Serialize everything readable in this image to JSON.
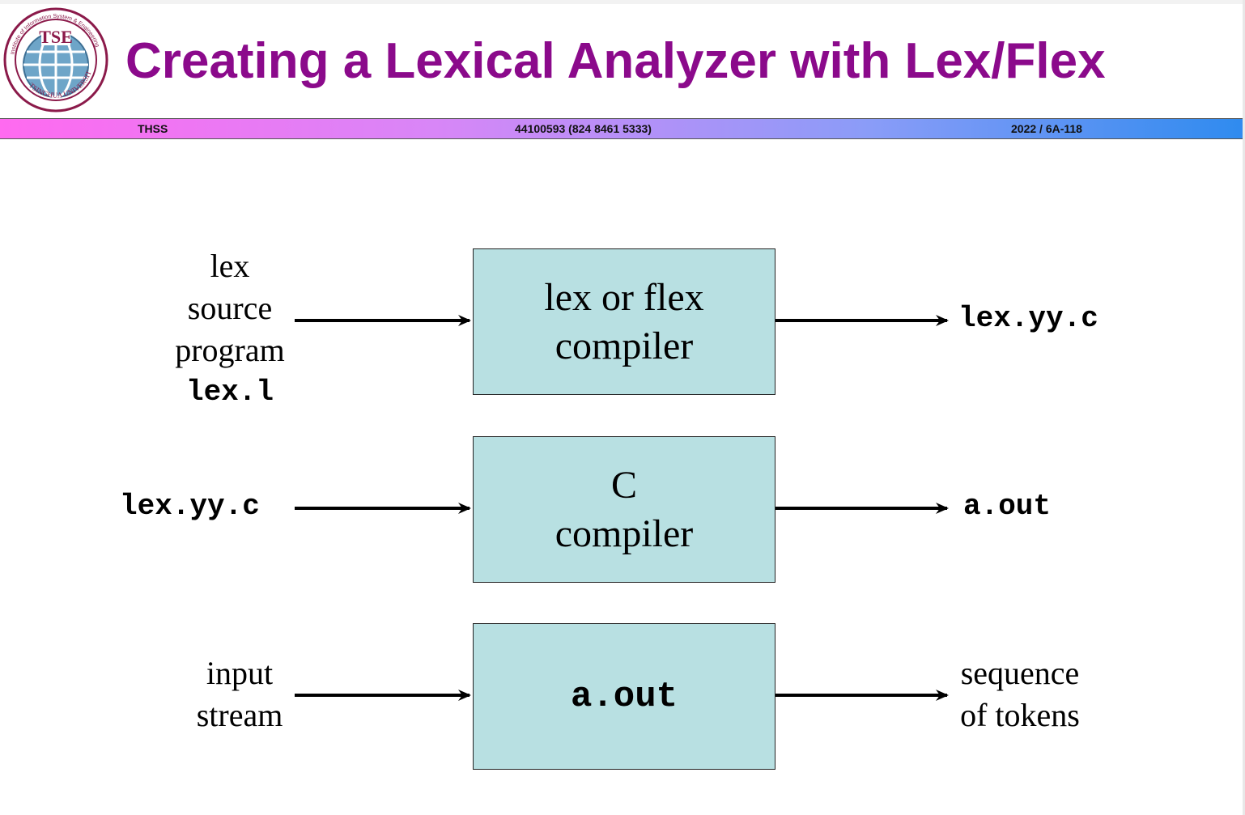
{
  "header": {
    "title": "Creating a Lexical Analyzer with Lex/Flex",
    "band_left": "THSS",
    "band_center": "44100593 (824 8461 5333)",
    "band_right": "2022 / 6A-118",
    "logo": {
      "center_text": "TSE",
      "ring_text_top": "Institute of Information System & Engineering",
      "ring_text_bottom": "TSINGHUA UNIVERSITY",
      "color": "#8b1a4a"
    }
  },
  "diagram": {
    "rows": [
      {
        "input_lines": [
          "lex",
          "source",
          "program"
        ],
        "input_code": "lex.l",
        "box_lines": [
          "lex or flex",
          "compiler"
        ],
        "output": "lex.yy.c"
      },
      {
        "input": "lex.yy.c",
        "box_lines": [
          "C",
          "compiler"
        ],
        "output": "a.out"
      },
      {
        "input_lines": [
          "input",
          "stream"
        ],
        "box_code": "a.out",
        "output_lines": [
          "sequence",
          "of tokens"
        ]
      }
    ],
    "colors": {
      "box_fill": "#b8e0e2",
      "title": "#8b0a8b"
    }
  }
}
